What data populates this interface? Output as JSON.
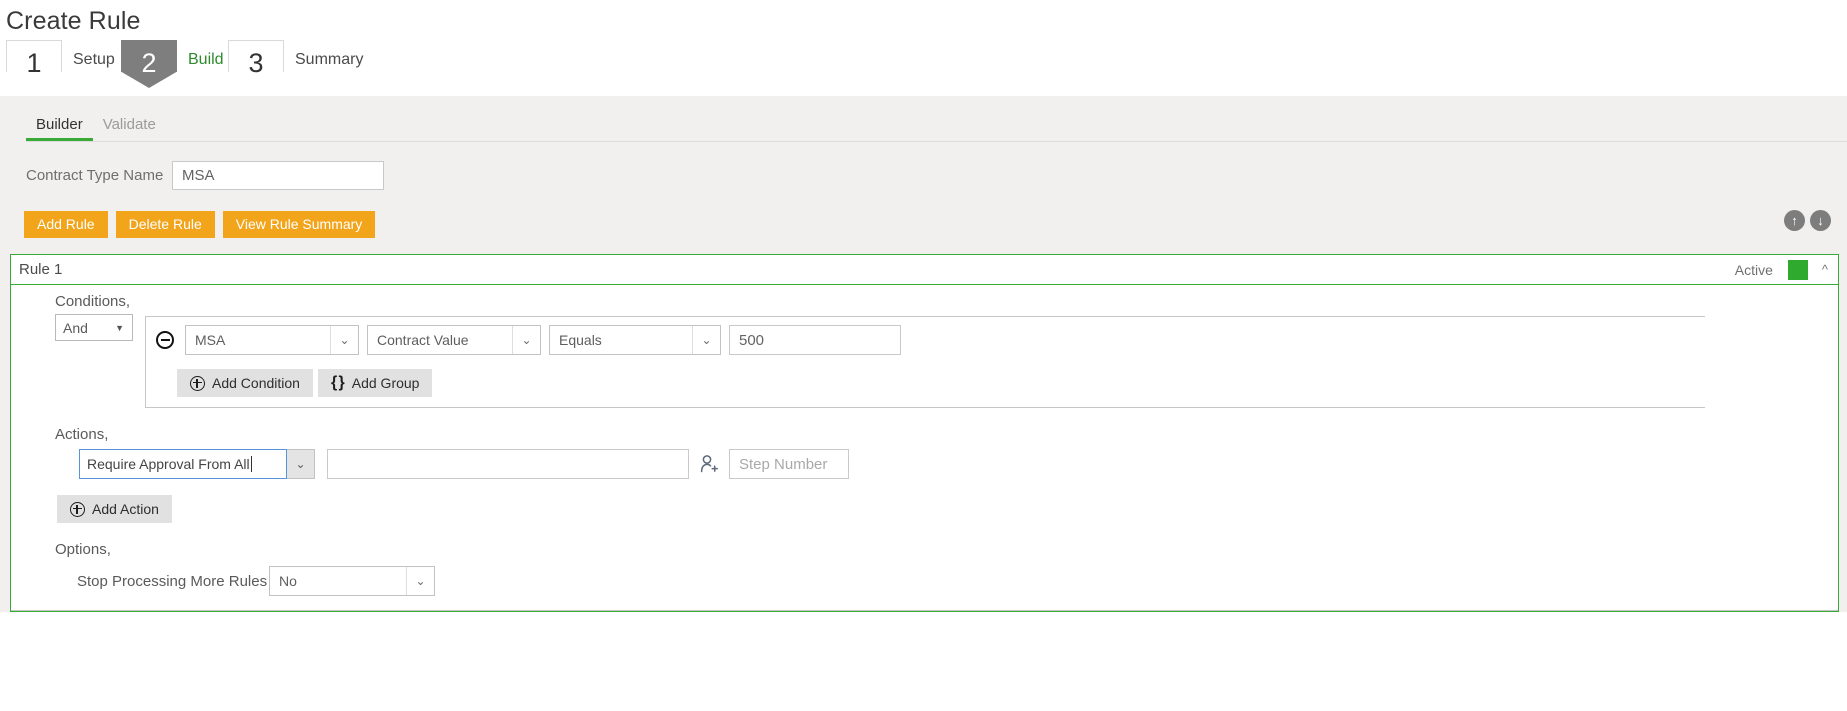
{
  "page": {
    "title": "Create Rule"
  },
  "wizard": {
    "steps": [
      {
        "number": "1",
        "label": "Setup",
        "active": false
      },
      {
        "number": "2",
        "label": "Build",
        "active": true
      },
      {
        "number": "3",
        "label": "Summary",
        "active": false
      }
    ]
  },
  "tabs": [
    {
      "label": "Builder",
      "active": true
    },
    {
      "label": "Validate",
      "active": false
    }
  ],
  "form": {
    "contract_type_label": "Contract Type Name",
    "contract_type_value": "MSA"
  },
  "toolbar": {
    "add_rule_label": "Add Rule",
    "delete_rule_label": "Delete Rule",
    "view_rule_summary_label": "View Rule Summary",
    "move_up_icon": "arrow-up-circle-icon",
    "move_down_icon": "arrow-down-circle-icon"
  },
  "rule": {
    "title": "Rule 1",
    "status_label": "Active",
    "status_color": "#2faa2f",
    "collapse_icon": "chevron-up-icon",
    "conditions": {
      "section_label": "Conditions,",
      "logic_value": "And",
      "rows": [
        {
          "field": "MSA",
          "attribute": "Contract Value",
          "operator": "Equals",
          "value": "500",
          "remove_icon": "minus-circle-icon"
        }
      ],
      "add_condition_label": "Add Condition",
      "add_group_label": "Add Group"
    },
    "actions": {
      "section_label": "Actions,",
      "rows": [
        {
          "action": "Require Approval From All",
          "param_value": "",
          "param_placeholder": "",
          "person_icon": "person-add-icon",
          "step_value": "",
          "step_placeholder": "Step Number"
        }
      ],
      "add_action_label": "Add Action"
    },
    "options": {
      "section_label": "Options,",
      "stop_processing_label": "Stop Processing More Rules",
      "stop_processing_value": "No"
    }
  },
  "colors": {
    "accent_orange": "#f2a41b",
    "accent_green": "#39aa35",
    "focus_blue": "#5596d8"
  }
}
